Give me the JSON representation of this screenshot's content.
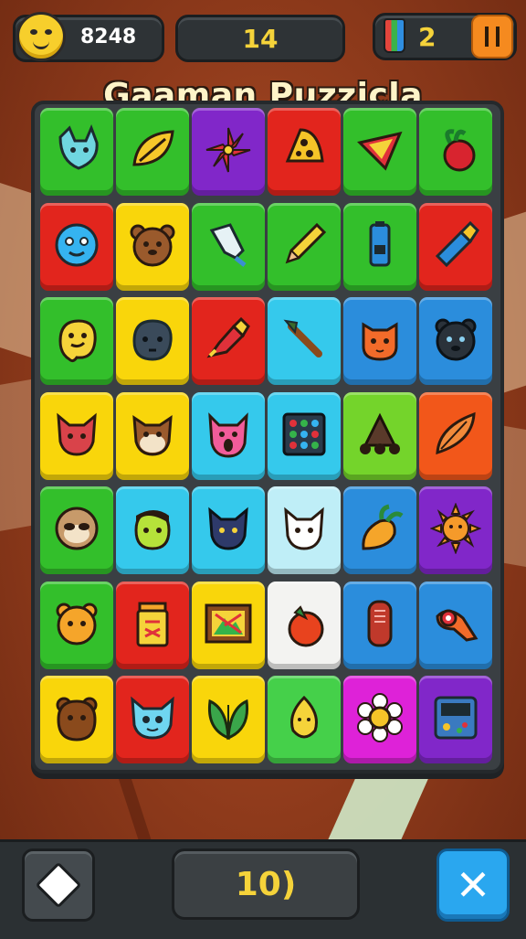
{
  "header": {
    "coins": "8248",
    "moves": "14",
    "lives": "2"
  },
  "title": "Gaaman Puzzicla",
  "board": {
    "columns": 6,
    "rows": 7,
    "tiles": [
      {
        "color": "green",
        "icon": "fox-head-icon"
      },
      {
        "color": "green",
        "icon": "leaf-icon"
      },
      {
        "color": "purple",
        "icon": "flower-icon"
      },
      {
        "color": "red",
        "icon": "cheese-icon"
      },
      {
        "color": "green",
        "icon": "nacho-icon"
      },
      {
        "color": "green",
        "icon": "radish-icon"
      },
      {
        "color": "red",
        "icon": "blue-face-icon"
      },
      {
        "color": "yellow",
        "icon": "bear-face-icon"
      },
      {
        "color": "green",
        "icon": "crystal-icon"
      },
      {
        "color": "green",
        "icon": "pencil-icon"
      },
      {
        "color": "green",
        "icon": "battery-icon"
      },
      {
        "color": "red",
        "icon": "crayon-icon"
      },
      {
        "color": "green",
        "icon": "yellow-blob-face-icon"
      },
      {
        "color": "yellow",
        "icon": "dark-blob-face-icon"
      },
      {
        "color": "red",
        "icon": "marker-icon"
      },
      {
        "color": "cyan",
        "icon": "brush-icon"
      },
      {
        "color": "blue",
        "icon": "orange-cat-icon"
      },
      {
        "color": "blue",
        "icon": "black-cat-icon"
      },
      {
        "color": "yellow",
        "icon": "red-cat-icon"
      },
      {
        "color": "yellow",
        "icon": "hamster-icon"
      },
      {
        "color": "cyan",
        "icon": "pink-pig-icon"
      },
      {
        "color": "cyan",
        "icon": "dot-grid-icon"
      },
      {
        "color": "lime",
        "icon": "cart-icon"
      },
      {
        "color": "orange",
        "icon": "feather-icon"
      },
      {
        "color": "green",
        "icon": "sloth-icon"
      },
      {
        "color": "cyan",
        "icon": "green-boy-icon"
      },
      {
        "color": "cyan",
        "icon": "navy-cat-icon"
      },
      {
        "color": "lightcyan",
        "icon": "white-cat-icon"
      },
      {
        "color": "blue",
        "icon": "carrot-icon"
      },
      {
        "color": "purple",
        "icon": "sun-icon"
      },
      {
        "color": "green",
        "icon": "orange-bear-icon"
      },
      {
        "color": "red",
        "icon": "jar-icon"
      },
      {
        "color": "yellow",
        "icon": "picture-frame-icon"
      },
      {
        "color": "white",
        "icon": "tomato-icon"
      },
      {
        "color": "blue",
        "icon": "capsule-icon"
      },
      {
        "color": "blue",
        "icon": "horn-icon"
      },
      {
        "color": "yellow",
        "icon": "brown-bear-icon"
      },
      {
        "color": "red",
        "icon": "blue-cat-icon"
      },
      {
        "color": "yellow",
        "icon": "leaf-pair-icon"
      },
      {
        "color": "brightgreen",
        "icon": "lemon-icon"
      },
      {
        "color": "magenta",
        "icon": "daisy-icon"
      },
      {
        "color": "purple",
        "icon": "game-console-icon"
      }
    ]
  },
  "footer": {
    "score": "10)"
  },
  "colors": {
    "green": "#33bf2b",
    "red": "#e2251d",
    "yellow": "#f9d60b",
    "purple": "#8127c9",
    "blue": "#2b8ddc",
    "cyan": "#35c9ec",
    "lime": "#74d42b",
    "orange": "#f2571a",
    "white": "#f3f3f1",
    "magenta": "#de22d8",
    "lightcyan": "#bfeef7",
    "brightgreen": "#45d04a"
  }
}
